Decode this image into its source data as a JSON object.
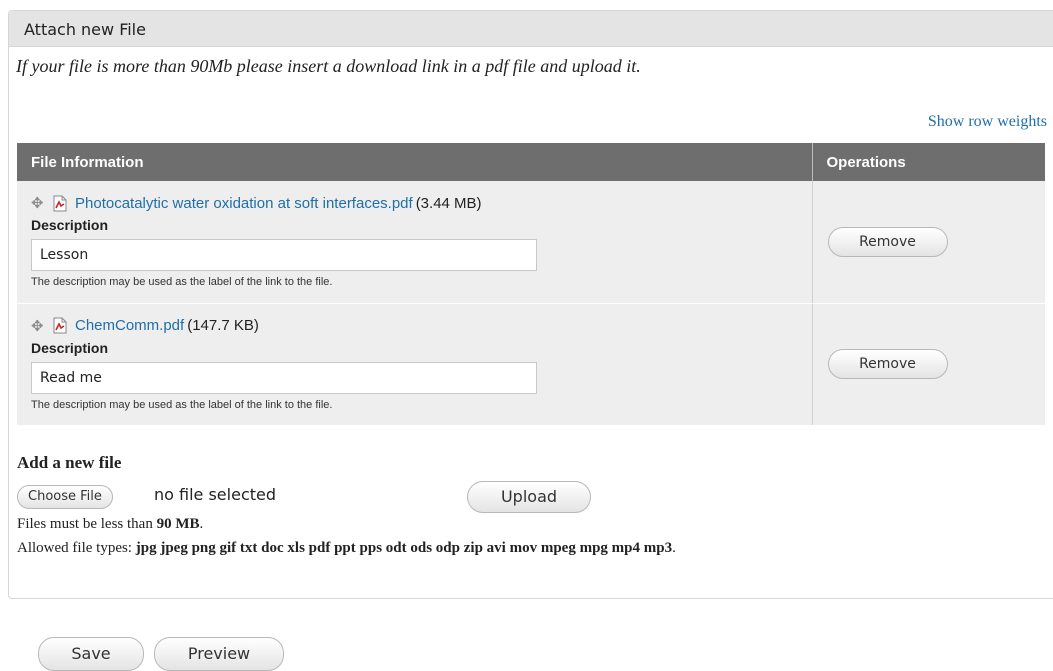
{
  "fieldset": {
    "legend": "Attach new File",
    "notice": "If your file is more than 90Mb please insert a download link in a pdf file and upload it.",
    "row_weights_link": "Show row weights"
  },
  "table": {
    "headers": [
      "File Information",
      "Operations"
    ],
    "rows": [
      {
        "file_name": "Photocatalytic water oxidation at soft interfaces.pdf",
        "file_size": "(3.44 MB)",
        "description_label": "Description",
        "description_value": "Lesson",
        "description_help": "The description may be used as the label of the link to the file.",
        "remove_label": "Remove"
      },
      {
        "file_name": "ChemComm.pdf",
        "file_size": "(147.7 KB)",
        "description_label": "Description",
        "description_value": "Read me",
        "description_help": "The description may be used as the label of the link to the file.",
        "remove_label": "Remove"
      }
    ]
  },
  "add_file": {
    "title": "Add a new file",
    "choose_label": "Choose File",
    "no_file_text": "no file selected",
    "upload_label": "Upload",
    "size_hint_prefix": "Files must be less than",
    "size_hint_value": "90 MB",
    "size_hint_suffix": ".",
    "types_prefix": "Allowed file types:",
    "types_value": "jpg jpeg png gif txt doc xls pdf ppt pps odt ods odp zip avi mov mpeg mpg mp4 mp3",
    "types_suffix": "."
  },
  "actions": {
    "save_label": "Save",
    "preview_label": "Preview"
  },
  "colors": {
    "link": "#1f6fa8",
    "header_bg": "#6e6e6e",
    "row_bg": "#eeeeee"
  },
  "icons": [
    "drag-handle-icon",
    "pdf-file-icon"
  ]
}
